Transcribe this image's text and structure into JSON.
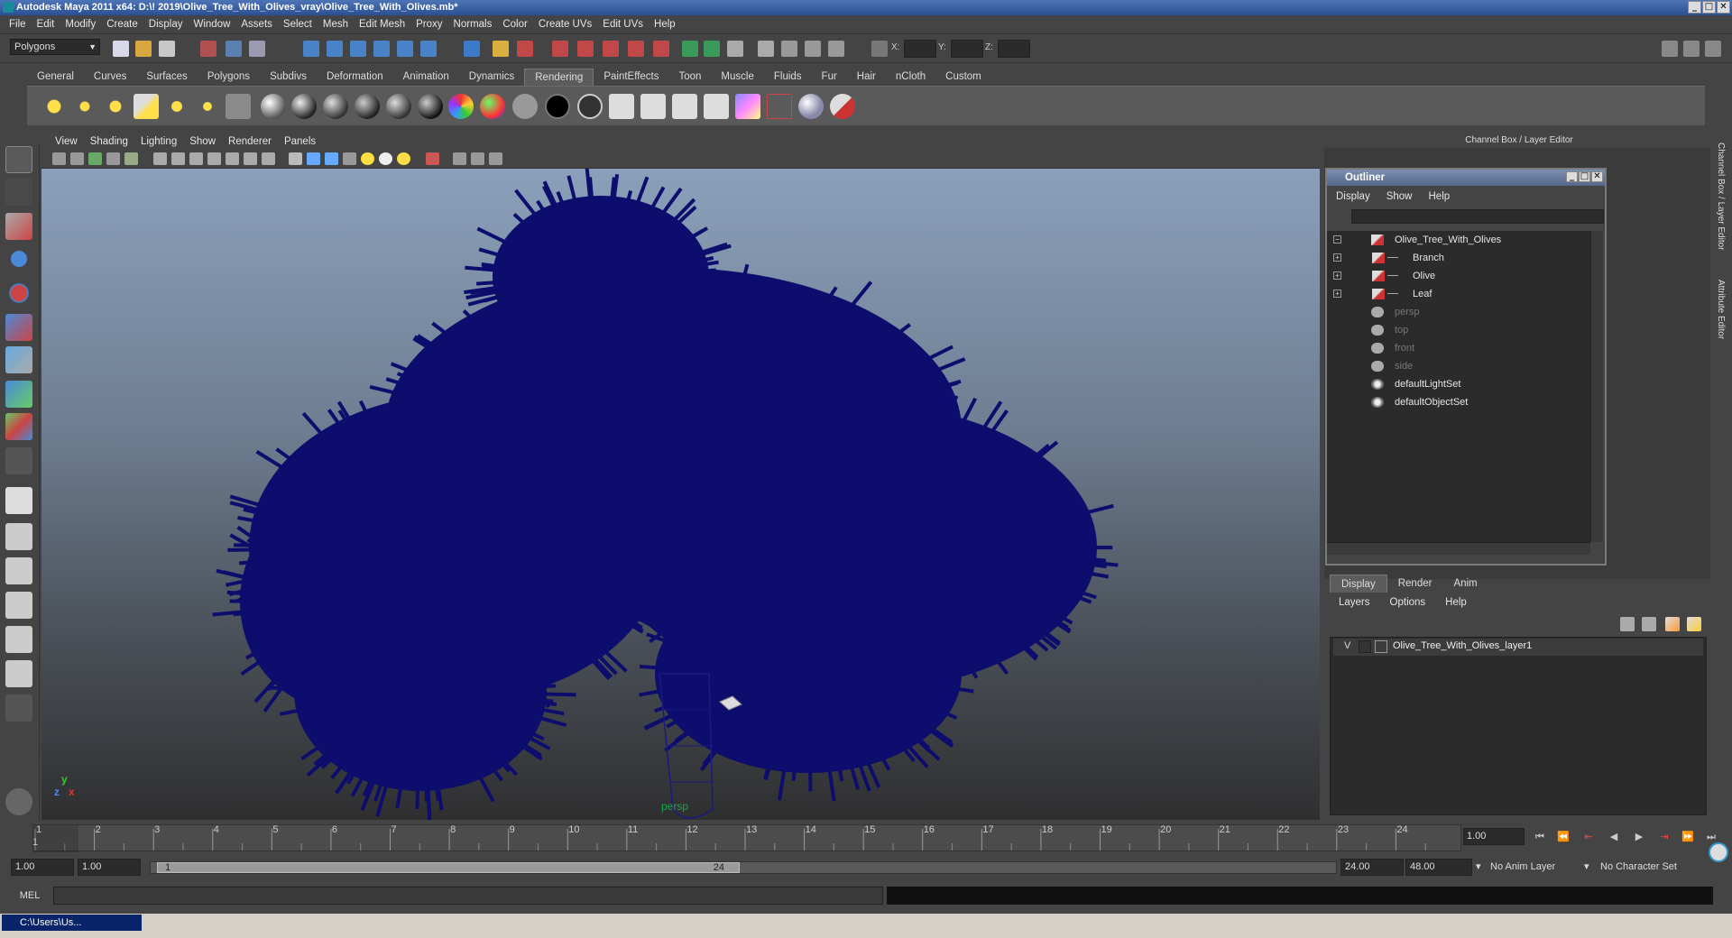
{
  "title_bar": {
    "title": "Autodesk Maya 2011 x64: D:\\! 2019\\Olive_Tree_With_Olives_vray\\Olive_Tree_With_Olives.mb*",
    "min": "_",
    "max": "□",
    "close": "✕"
  },
  "menu": [
    "File",
    "Edit",
    "Modify",
    "Create",
    "Display",
    "Window",
    "Assets",
    "Select",
    "Mesh",
    "Edit Mesh",
    "Proxy",
    "Normals",
    "Color",
    "Create UVs",
    "Edit UVs",
    "Help"
  ],
  "status_line": {
    "mode": "Polygons",
    "x_label": "X:",
    "y_label": "Y:",
    "z_label": "Z:"
  },
  "shelf_tabs": [
    "General",
    "Curves",
    "Surfaces",
    "Polygons",
    "Subdivs",
    "Deformation",
    "Animation",
    "Dynamics",
    "Rendering",
    "PaintEffects",
    "Toon",
    "Muscle",
    "Fluids",
    "Fur",
    "Hair",
    "nCloth",
    "Custom"
  ],
  "active_shelf_tab": "Rendering",
  "viewport": {
    "menu": [
      "View",
      "Shading",
      "Lighting",
      "Show",
      "Renderer",
      "Panels"
    ],
    "camera": "persp",
    "axis_y": "y",
    "axis_x": "x",
    "axis_z": "z",
    "model_color": "#0d0d6e"
  },
  "channel_box": {
    "header": "Channel Box / Layer Editor"
  },
  "outliner": {
    "title": "Outliner",
    "menu": [
      "Display",
      "Show",
      "Help"
    ],
    "items": [
      {
        "label": "Olive_Tree_With_Olives",
        "type": "root",
        "dim": false
      },
      {
        "label": "Branch",
        "type": "child",
        "dim": false
      },
      {
        "label": "Olive",
        "type": "child",
        "dim": false
      },
      {
        "label": "Leaf",
        "type": "child",
        "dim": false
      },
      {
        "label": "persp",
        "type": "camera",
        "dim": true
      },
      {
        "label": "top",
        "type": "camera",
        "dim": true
      },
      {
        "label": "front",
        "type": "camera",
        "dim": true
      },
      {
        "label": "side",
        "type": "camera",
        "dim": true
      },
      {
        "label": "defaultLightSet",
        "type": "set",
        "dim": false
      },
      {
        "label": "defaultObjectSet",
        "type": "set",
        "dim": false
      }
    ]
  },
  "layer_editor": {
    "tabs": [
      "Display",
      "Render",
      "Anim"
    ],
    "active_tab": "Display",
    "menu": [
      "Layers",
      "Options",
      "Help"
    ],
    "layer": {
      "visible": "V",
      "name": "Olive_Tree_With_Olives_layer1"
    }
  },
  "side_tabs": [
    "Channel Box / Layer Editor",
    "Attribute Editor"
  ],
  "time_slider": {
    "ticks": [
      "1",
      "2",
      "3",
      "4",
      "5",
      "6",
      "7",
      "8",
      "9",
      "10",
      "11",
      "12",
      "13",
      "14",
      "15",
      "16",
      "17",
      "18",
      "19",
      "20",
      "21",
      "22",
      "23",
      "24"
    ],
    "current_marker": "1",
    "current_frame": "1.00"
  },
  "range": {
    "start": "1.00",
    "playback_start": "1.00",
    "slider_start": "1",
    "slider_end": "24",
    "playback_end": "24.00",
    "end": "48.00",
    "anim_layer": "No Anim Layer",
    "character_set": "No Character Set"
  },
  "command_line": {
    "label": "MEL"
  },
  "taskbar": {
    "item": "C:\\Users\\Us..."
  }
}
